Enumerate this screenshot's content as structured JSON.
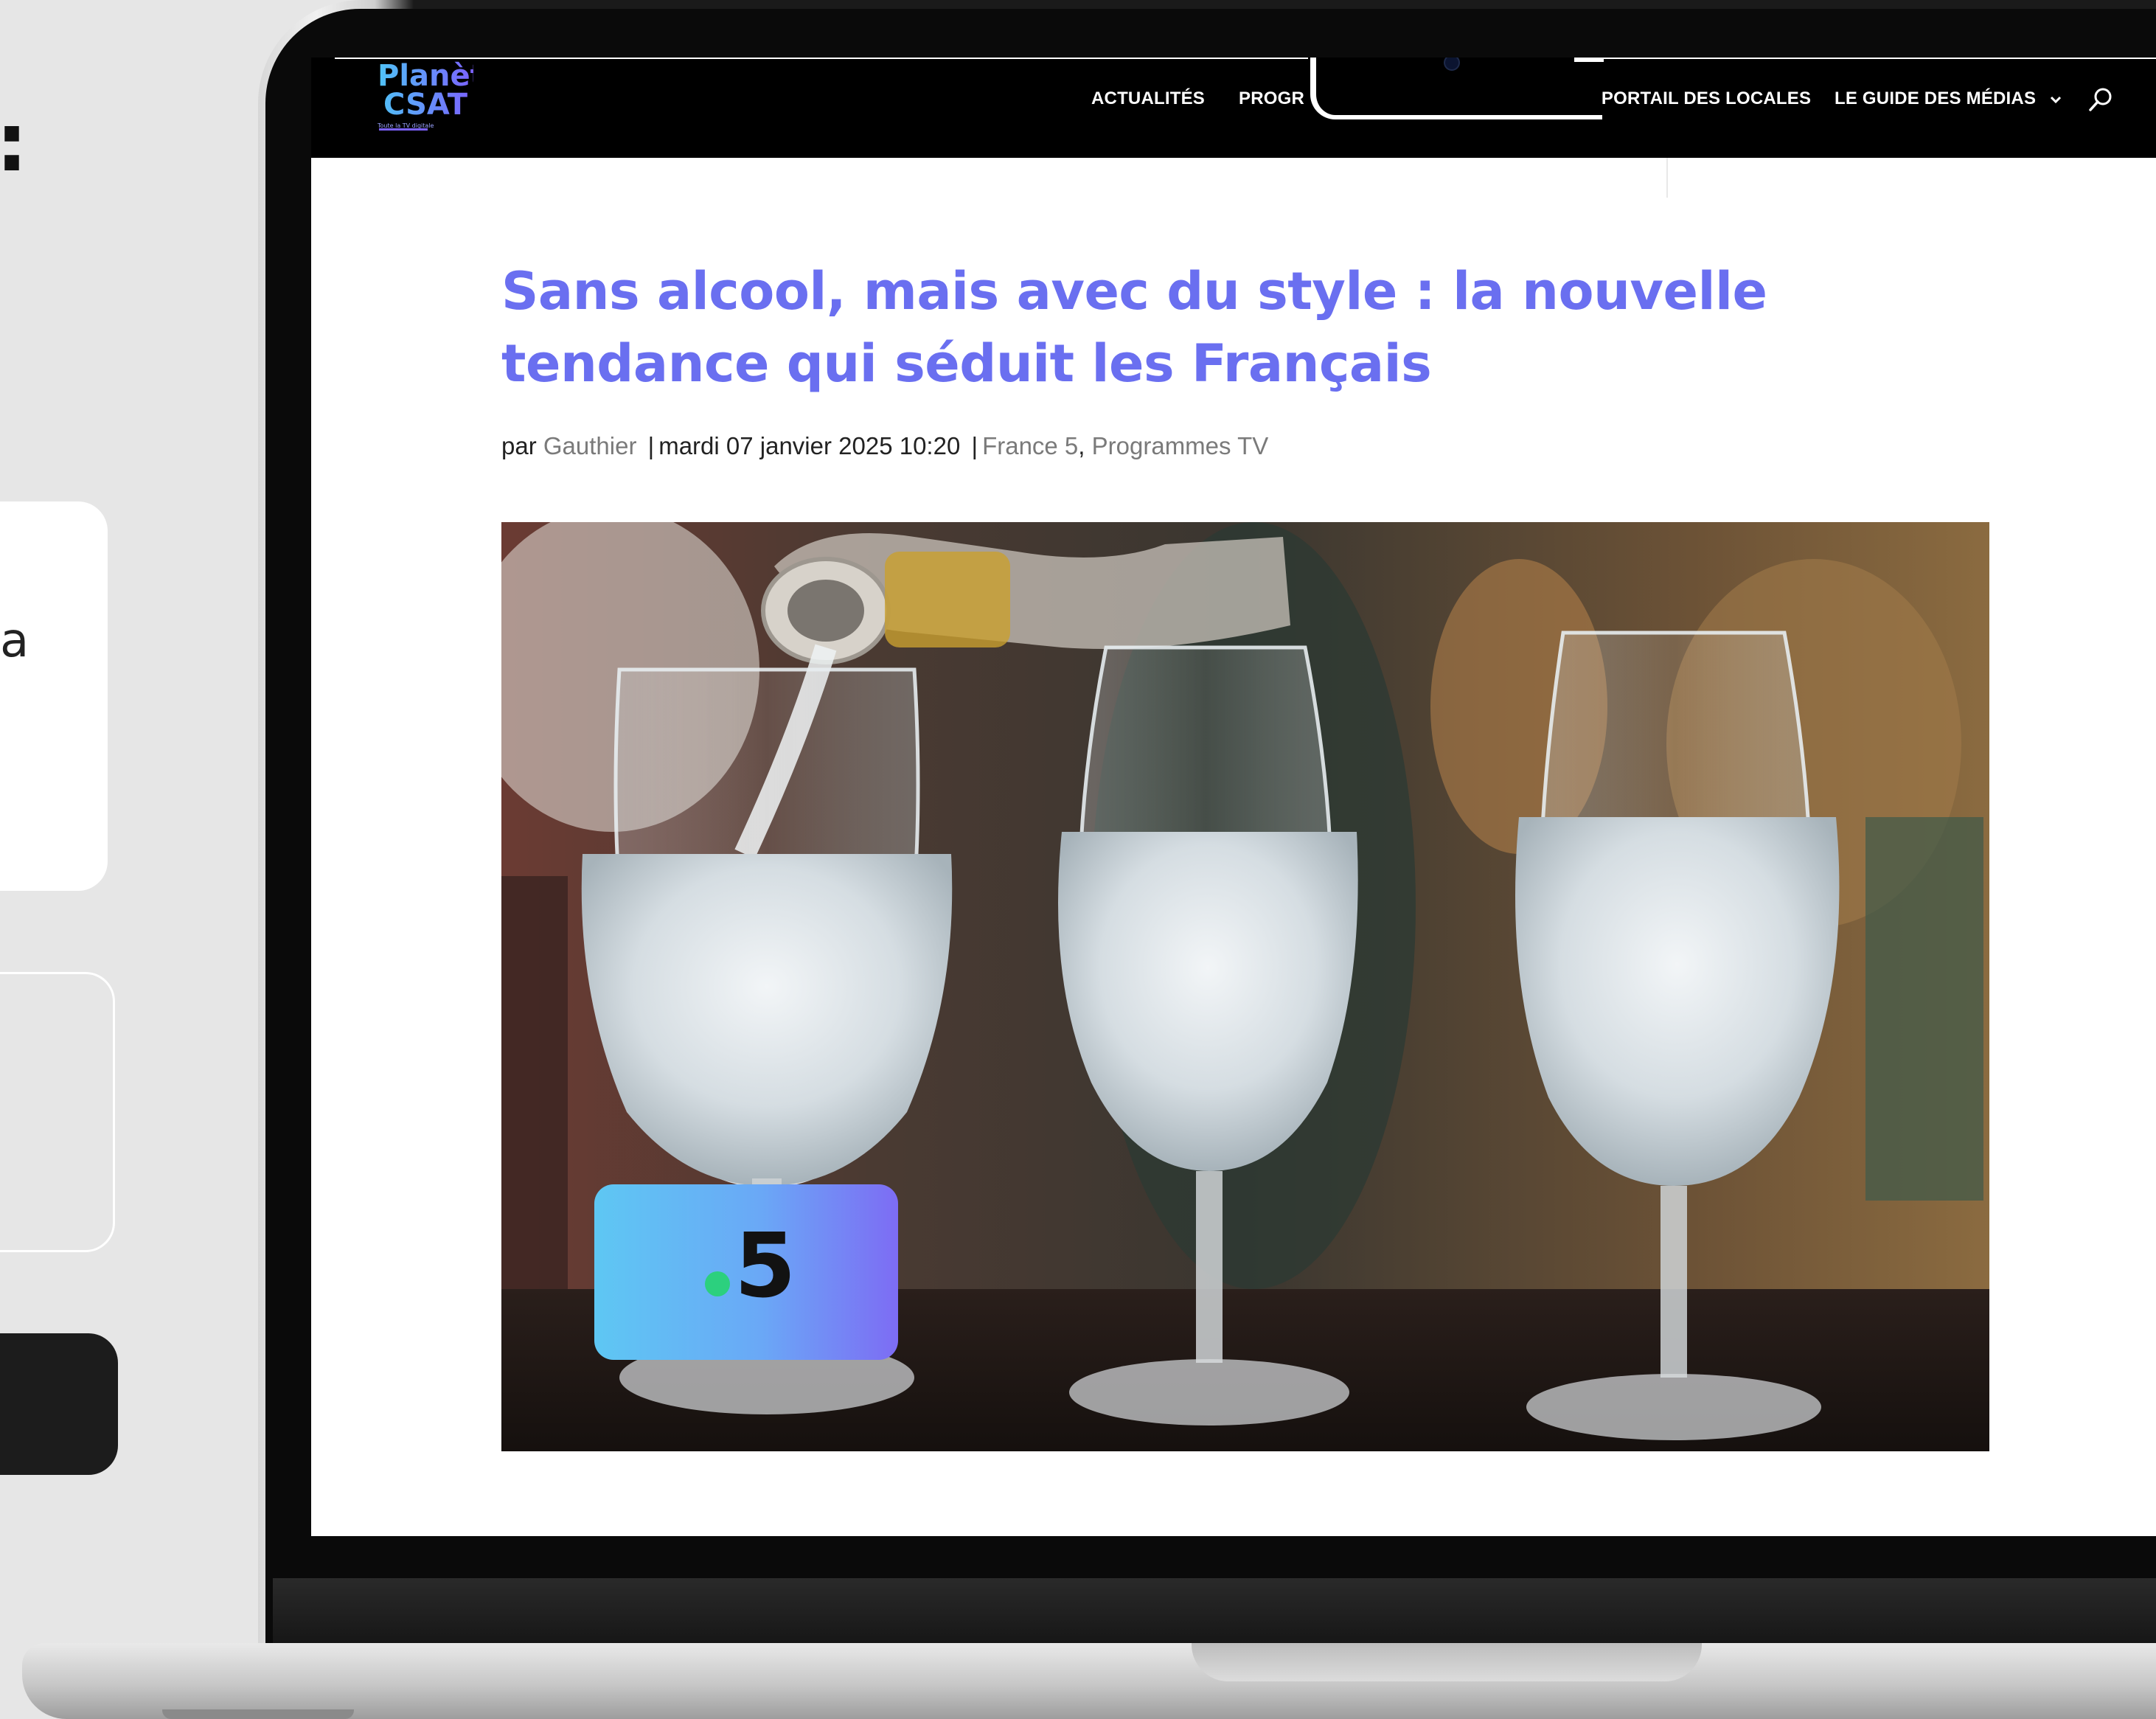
{
  "page": {
    "background": "#e6e6e6",
    "left_fragment_colon": ":",
    "left_fragment_letter": "a"
  },
  "site": {
    "logo_line1": "Planète",
    "logo_line2": "CSAT",
    "logo_tagline": "Toute la TV digitale",
    "accent_color": "#6a6ff0"
  },
  "nav": {
    "items": [
      {
        "label": "ACTUALITÉS"
      },
      {
        "label": "PROGR"
      },
      {
        "label": "LE PORTAIL DES LOCALES"
      },
      {
        "label": "LE GUIDE DES MÉDIAS"
      }
    ],
    "dropdown_icon": "chevron-down-icon",
    "search_icon": "search-icon"
  },
  "article": {
    "title": "Sans alcool, mais avec du style : la nouvelle tendance qui séduit les Français",
    "meta": {
      "by_prefix": "par",
      "author": "Gauthier",
      "separator": "|",
      "date": "mardi 07 janvier 2025 10:20",
      "category1": "France 5",
      "comma": ",",
      "category2": "Programmes TV"
    },
    "hero": {
      "description_icon": "three-wine-glasses-photo",
      "channel_badge_number": "5",
      "channel_badge_colors": [
        "#5ec7f3",
        "#7d6cf4"
      ],
      "channel_dot_color": "#2cd07e"
    }
  }
}
